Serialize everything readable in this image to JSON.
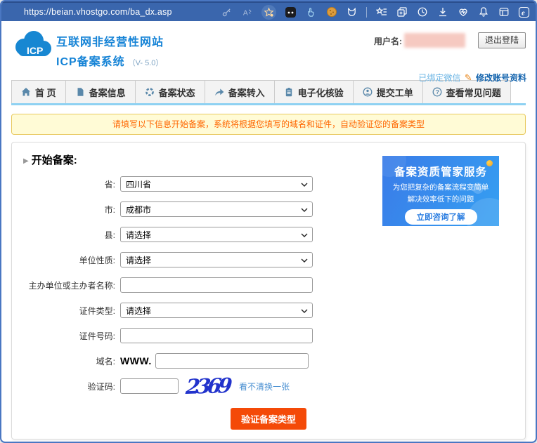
{
  "browser": {
    "url": "https://beian.vhostgo.com/ba_dx.asp",
    "toolbar_icons": [
      "password-key",
      "read-aloud",
      "add-favorite-star",
      "extension-dark",
      "hand-pointer",
      "cookie-extension",
      "fox-extension",
      "favorites",
      "collections",
      "history",
      "downloads",
      "browser-essentials",
      "notifications",
      "workspaces",
      "edge-menu"
    ]
  },
  "header": {
    "logo_text": "ICP",
    "title_line1": "互联网非经营性网站",
    "title_line2": "ICP备案系统",
    "version": "（V- 5.0）",
    "username_label": "用户名:",
    "logout_button": "退出登陆",
    "wechat_status": "已绑定微信",
    "edit_account": "修改账号资料"
  },
  "nav": {
    "tabs": [
      {
        "label": "首 页",
        "icon": "home-icon"
      },
      {
        "label": "备案信息",
        "icon": "document-icon"
      },
      {
        "label": "备案状态",
        "icon": "status-icon"
      },
      {
        "label": "备案转入",
        "icon": "transfer-arrow-icon"
      },
      {
        "label": "电子化核验",
        "icon": "clipboard-icon"
      },
      {
        "label": "提交工单",
        "icon": "user-icon"
      },
      {
        "label": "查看常见问题",
        "icon": "question-icon"
      }
    ]
  },
  "notice": {
    "text": "请填写以下信息开始备案，系统将根据您填写的域名和证件，自动验证您的备案类型"
  },
  "form": {
    "heading": "开始备案:",
    "fields": [
      {
        "label": "省:",
        "type": "select",
        "value": "四川省"
      },
      {
        "label": "市:",
        "type": "select",
        "value": "成都市"
      },
      {
        "label": "县:",
        "type": "select",
        "value": "请选择"
      },
      {
        "label": "单位性质:",
        "type": "select",
        "value": "请选择"
      },
      {
        "label": "主办单位或主办者名称:",
        "type": "text",
        "value": ""
      },
      {
        "label": "证件类型:",
        "type": "select",
        "value": "请选择"
      },
      {
        "label": "证件号码:",
        "type": "text",
        "value": ""
      },
      {
        "label": "域名:",
        "type": "text",
        "prefix": "WWW.",
        "value": ""
      },
      {
        "label": "验证码:",
        "type": "captcha",
        "value": ""
      }
    ],
    "captcha_text": "2369",
    "captcha_refresh": "看不清换一张",
    "submit_button": "验证备案类型"
  },
  "ad": {
    "title": "备案资质管家服务",
    "line1": "为您把复杂的备案流程变简单",
    "line2": "解决效率低下的问题",
    "button": "立即咨询了解"
  },
  "colors": {
    "browser_bar": "#3a66ad",
    "brand_blue": "#1583d6",
    "nav_underline": "#8ed1f2",
    "notice_bg": "#fffbd6",
    "notice_border": "#e8c95f",
    "notice_text": "#ff6600",
    "submit_button": "#f44a08",
    "ad_gradient_start": "#3a7be8",
    "ad_gradient_end": "#35a0f2",
    "captcha_blue": "#2233cc",
    "link_blue": "#4a90d2"
  }
}
